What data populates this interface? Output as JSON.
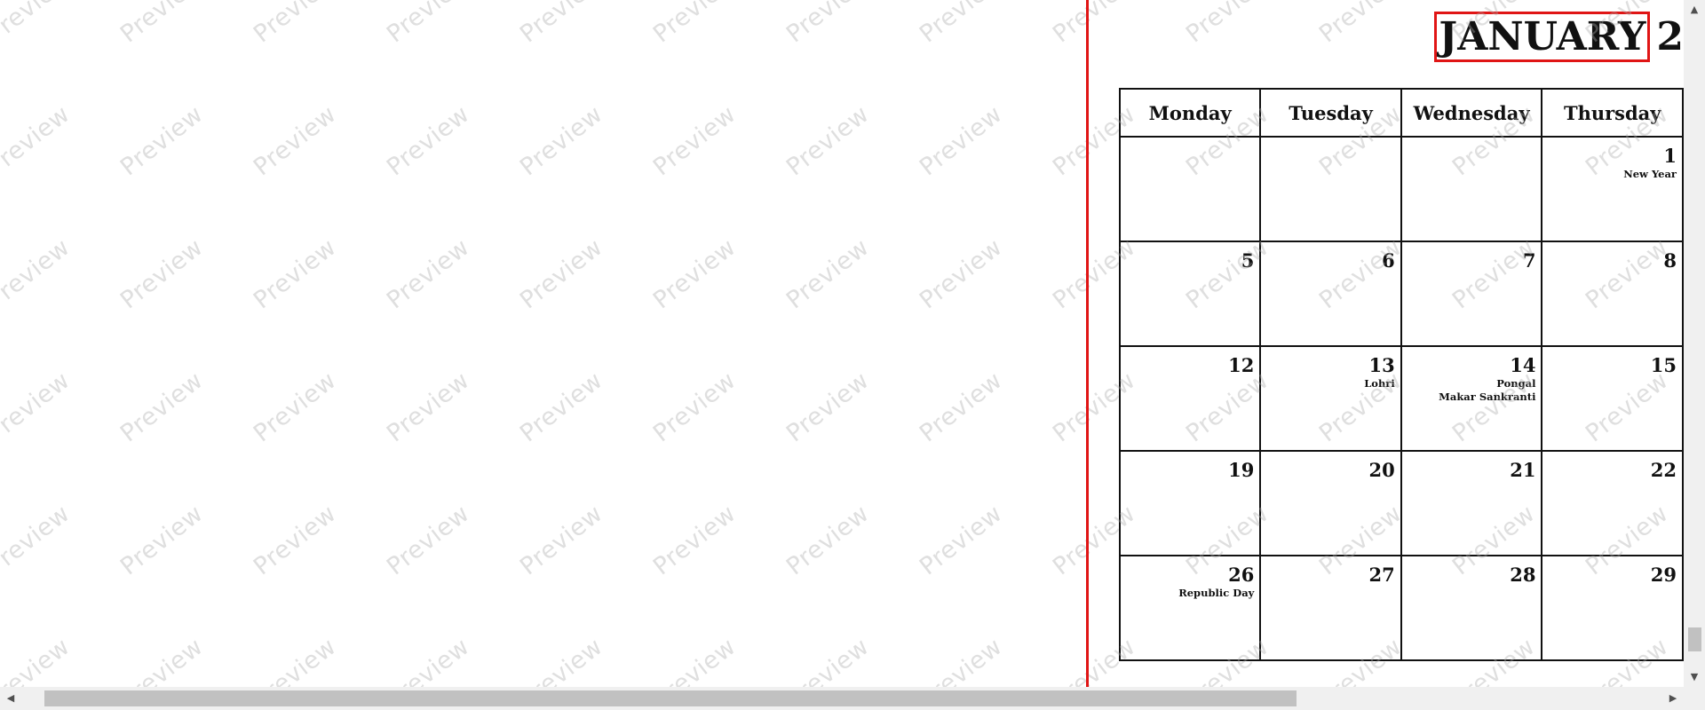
{
  "watermark_text": "Preview",
  "calendar": {
    "month": "JANUARY",
    "year_partial": "2",
    "weekdays": [
      "Monday",
      "Tuesday",
      "Wednesday",
      "Thursday"
    ],
    "weeks": [
      [
        {
          "day": "",
          "holidays": []
        },
        {
          "day": "",
          "holidays": []
        },
        {
          "day": "",
          "holidays": []
        },
        {
          "day": "1",
          "holidays": [
            "New Year"
          ]
        }
      ],
      [
        {
          "day": "5",
          "holidays": []
        },
        {
          "day": "6",
          "holidays": []
        },
        {
          "day": "7",
          "holidays": []
        },
        {
          "day": "8",
          "holidays": []
        }
      ],
      [
        {
          "day": "12",
          "holidays": []
        },
        {
          "day": "13",
          "holidays": [
            "Lohri"
          ]
        },
        {
          "day": "14",
          "holidays": [
            "Pongal",
            "Makar Sankranti"
          ]
        },
        {
          "day": "15",
          "holidays": []
        }
      ],
      [
        {
          "day": "19",
          "holidays": []
        },
        {
          "day": "20",
          "holidays": []
        },
        {
          "day": "21",
          "holidays": []
        },
        {
          "day": "22",
          "holidays": []
        }
      ],
      [
        {
          "day": "26",
          "holidays": [
            "Republic Day"
          ]
        },
        {
          "day": "27",
          "holidays": []
        },
        {
          "day": "28",
          "holidays": []
        },
        {
          "day": "29",
          "holidays": []
        }
      ]
    ]
  },
  "colors": {
    "accent_red": "#e01515",
    "grid_line": "#111111",
    "watermark": "#aaaaaa",
    "scrollbar_track": "#f0f0f0",
    "scrollbar_thumb": "#c1c1c1"
  },
  "scrollbars": {
    "up_icon": "▲",
    "down_icon": "▼",
    "left_icon": "◀",
    "right_icon": "▶"
  }
}
